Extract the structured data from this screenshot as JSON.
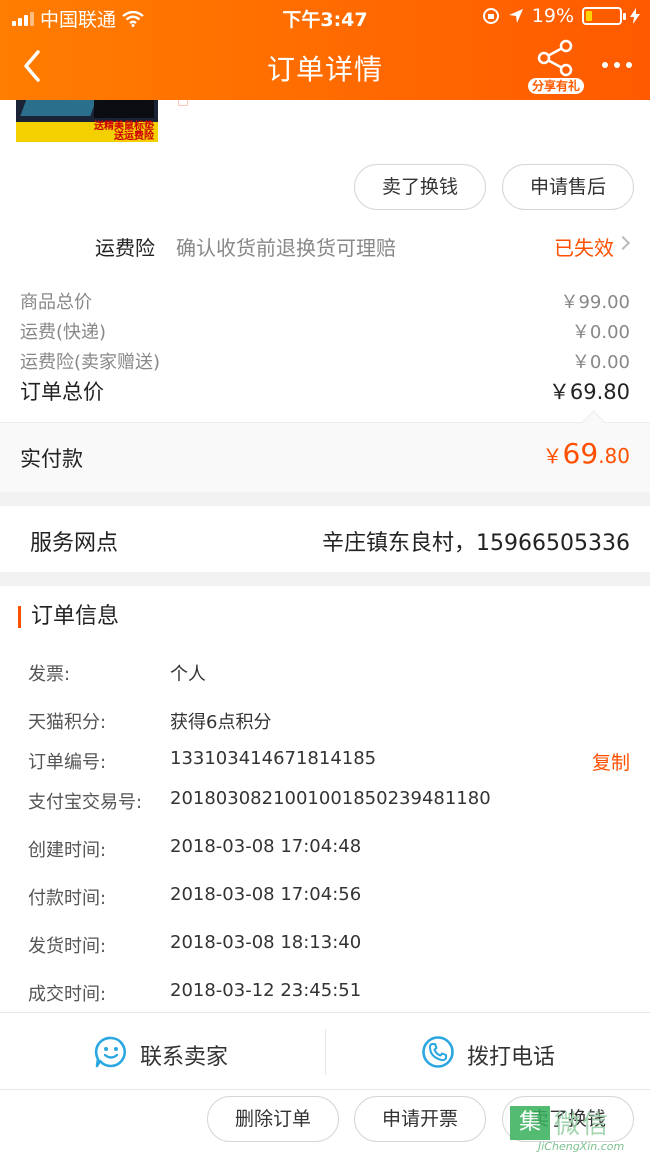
{
  "status_bar": {
    "carrier": "中国联通",
    "time": "下午3:47",
    "battery": "19%",
    "battery_level": 0.19
  },
  "nav": {
    "title": "订单详情",
    "share_label": "分享有礼"
  },
  "product": {
    "promo_text": "送精美鼠标垫",
    "promo_text2": "送运费险",
    "buttons": [
      "卖了换钱",
      "申请售后"
    ]
  },
  "insurance": {
    "label": "运费险",
    "desc": "确认收货前退换货可理赔",
    "status": "已失效"
  },
  "fees": [
    {
      "label": "商品总价",
      "value": "￥99.00"
    },
    {
      "label": "运费(快递)",
      "value": "￥0.00"
    },
    {
      "label": "运费险(卖家赠送)",
      "value": "￥0.00"
    }
  ],
  "order_total": {
    "label": "订单总价",
    "value": "￥69.80"
  },
  "paid": {
    "label": "实付款",
    "currency": "￥",
    "integer": "69",
    "decimal": ".80"
  },
  "service_point": {
    "label": "服务网点",
    "value": "辛庄镇东良村，15966505336"
  },
  "order_info": {
    "title": "订单信息",
    "rows": [
      {
        "label": "发票:",
        "value": "个人"
      },
      {
        "label": "天猫积分:",
        "value": "获得6点积分"
      },
      {
        "label": "订单编号:",
        "value": "133103414671814185",
        "action": "复制"
      },
      {
        "label": "支付宝交易号:",
        "value": "2018030821001001850239481180"
      },
      {
        "label": "创建时间:",
        "value": "2018-03-08 17:04:48"
      },
      {
        "label": "付款时间:",
        "value": "2018-03-08 17:04:56"
      },
      {
        "label": "发货时间:",
        "value": "2018-03-08 18:13:40"
      },
      {
        "label": "成交时间:",
        "value": "2018-03-12 23:45:51"
      }
    ]
  },
  "contact": {
    "seller": "联系卖家",
    "phone": "拨打电话"
  },
  "bottom_actions": [
    "删除订单",
    "申请开票",
    "卖了换钱"
  ],
  "watermark": {
    "icon": "集",
    "text": "微信",
    "url": "JiChengXin.com"
  },
  "colors": {
    "accent": "#ff5000",
    "nav_from": "#ff7d00",
    "nav_to": "#ff5a00",
    "icon_blue": "#2aa7e0"
  }
}
